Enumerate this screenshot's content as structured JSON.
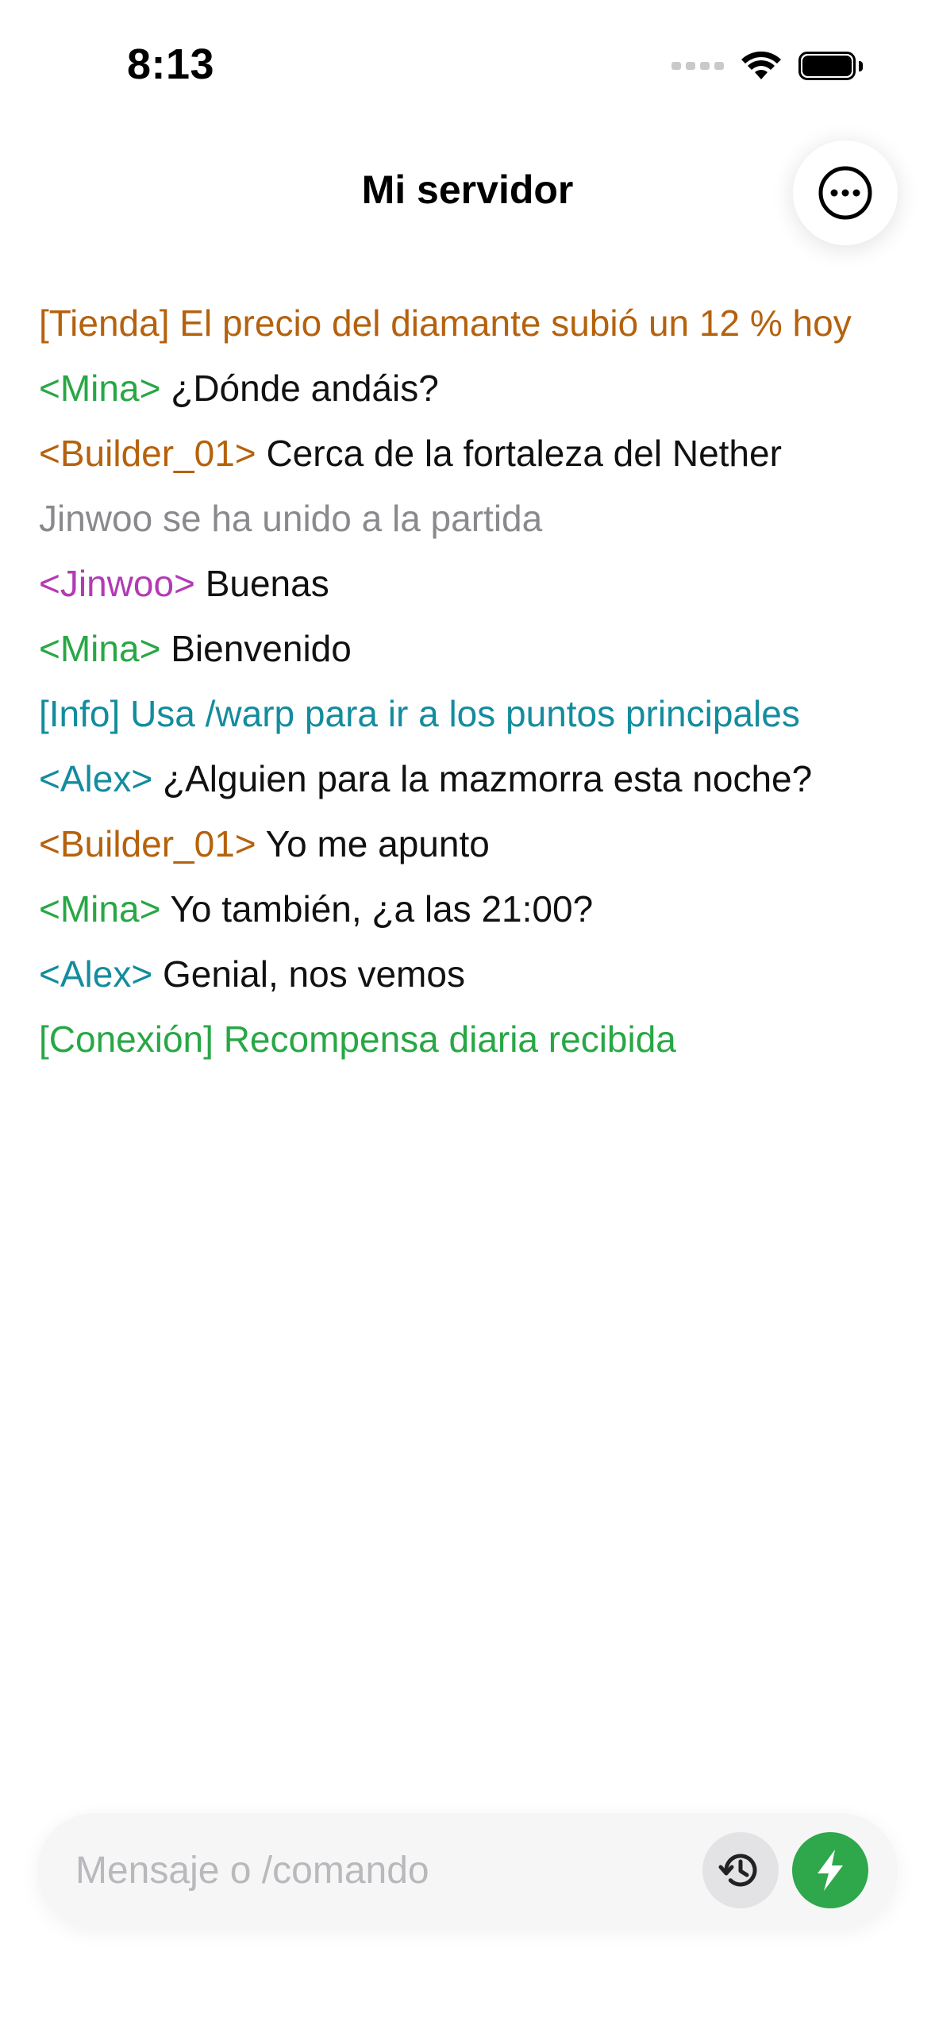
{
  "status_bar": {
    "time": "8:13",
    "icons": [
      "cellular-signal-icon",
      "wifi-icon",
      "battery-icon"
    ]
  },
  "header": {
    "title": "Mi servidor",
    "more_icon": "ellipsis-circle-icon"
  },
  "colors": {
    "shop": "#b5620e",
    "mina": "#28a745",
    "system": "#8a8a8e",
    "jinwoo": "#b23bb5",
    "info": "#138c9e",
    "alex": "#138c9e",
    "builder": "#b5620e",
    "message": "#111111",
    "send_button": "#2ea84a"
  },
  "chat": [
    {
      "prefix": "[Tienda] El precio del diamante subió un 12 % hoy",
      "text": ""
    },
    {
      "prefix": "<Mina>",
      "text": " ¿Dónde andáis?"
    },
    {
      "prefix": "<Builder_01>",
      "text": " Cerca de la fortaleza del Nether"
    },
    {
      "prefix": "Jinwoo se ha unido a la partida",
      "text": ""
    },
    {
      "prefix": "<Jinwoo>",
      "text": " Buenas"
    },
    {
      "prefix": "<Mina>",
      "text": " Bienvenido"
    },
    {
      "prefix": "[Info] Usa /warp para ir a los puntos principales",
      "text": ""
    },
    {
      "prefix": "<Alex>",
      "text": " ¿Alguien para la mazmorra esta noche?"
    },
    {
      "prefix": "<Builder_01>",
      "text": " Yo me apunto"
    },
    {
      "prefix": "<Mina>",
      "text": " Yo también, ¿a las 21:00?"
    },
    {
      "prefix": "<Alex>",
      "text": " Genial, nos vemos"
    },
    {
      "prefix": "[Conexión] Recompensa diaria recibida",
      "text": ""
    }
  ],
  "composer": {
    "placeholder": "Mensaje o /comando",
    "value": "",
    "history_icon": "history-clock-icon",
    "send_icon": "lightning-bolt-icon"
  }
}
